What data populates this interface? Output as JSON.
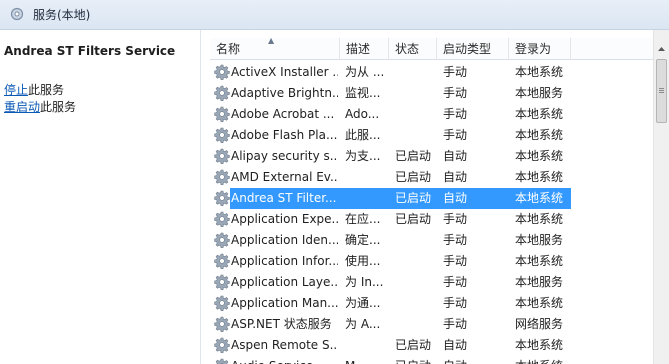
{
  "window": {
    "title": "服务(本地)"
  },
  "left_pane": {
    "service_title": "Andrea ST Filters Service",
    "stop_link": "停止",
    "stop_suffix": "此服务",
    "restart_link": "重启动",
    "restart_suffix": "此服务"
  },
  "columns": {
    "name": "名称",
    "description": "描述",
    "status": "状态",
    "startup_type": "启动类型",
    "log_on_as": "登录为"
  },
  "rows": [
    {
      "name": "ActiveX Installer ...",
      "description": "为从 ...",
      "status": "",
      "startup": "手动",
      "logon": "本地系统"
    },
    {
      "name": "Adaptive Brightn...",
      "description": "监视...",
      "status": "",
      "startup": "手动",
      "logon": "本地服务"
    },
    {
      "name": "Adobe Acrobat ...",
      "description": "Ado...",
      "status": "",
      "startup": "手动",
      "logon": "本地系统"
    },
    {
      "name": "Adobe Flash Pla...",
      "description": "此服...",
      "status": "",
      "startup": "手动",
      "logon": "本地系统"
    },
    {
      "name": "Alipay security s...",
      "description": "为支...",
      "status": "已启动",
      "startup": "自动",
      "logon": "本地系统"
    },
    {
      "name": "AMD External Ev...",
      "description": "",
      "status": "已启动",
      "startup": "自动",
      "logon": "本地系统"
    },
    {
      "name": "Andrea ST Filter...",
      "description": "",
      "status": "已启动",
      "startup": "自动",
      "logon": "本地系统"
    },
    {
      "name": "Application Expe...",
      "description": "在应...",
      "status": "已启动",
      "startup": "手动",
      "logon": "本地系统"
    },
    {
      "name": "Application Iden...",
      "description": "确定...",
      "status": "",
      "startup": "手动",
      "logon": "本地服务"
    },
    {
      "name": "Application Infor...",
      "description": "使用...",
      "status": "",
      "startup": "手动",
      "logon": "本地系统"
    },
    {
      "name": "Application Laye...",
      "description": "为 In...",
      "status": "",
      "startup": "手动",
      "logon": "本地服务"
    },
    {
      "name": "Application Man...",
      "description": "为通...",
      "status": "",
      "startup": "手动",
      "logon": "本地系统"
    },
    {
      "name": "ASP.NET 状态服务",
      "description": "为 A...",
      "status": "",
      "startup": "手动",
      "logon": "网络服务"
    },
    {
      "name": "Aspen Remote S...",
      "description": "",
      "status": "已启动",
      "startup": "自动",
      "logon": "本地系统"
    },
    {
      "name": "Audio Service",
      "description": "M...",
      "status": "已启动",
      "startup": "自动",
      "logon": "本地系统"
    }
  ],
  "selected_row": 6,
  "colors": {
    "selection": "#3399ff",
    "link": "#0b59b5"
  },
  "icons": {
    "service": "gear-icon",
    "title": "services-icon"
  }
}
